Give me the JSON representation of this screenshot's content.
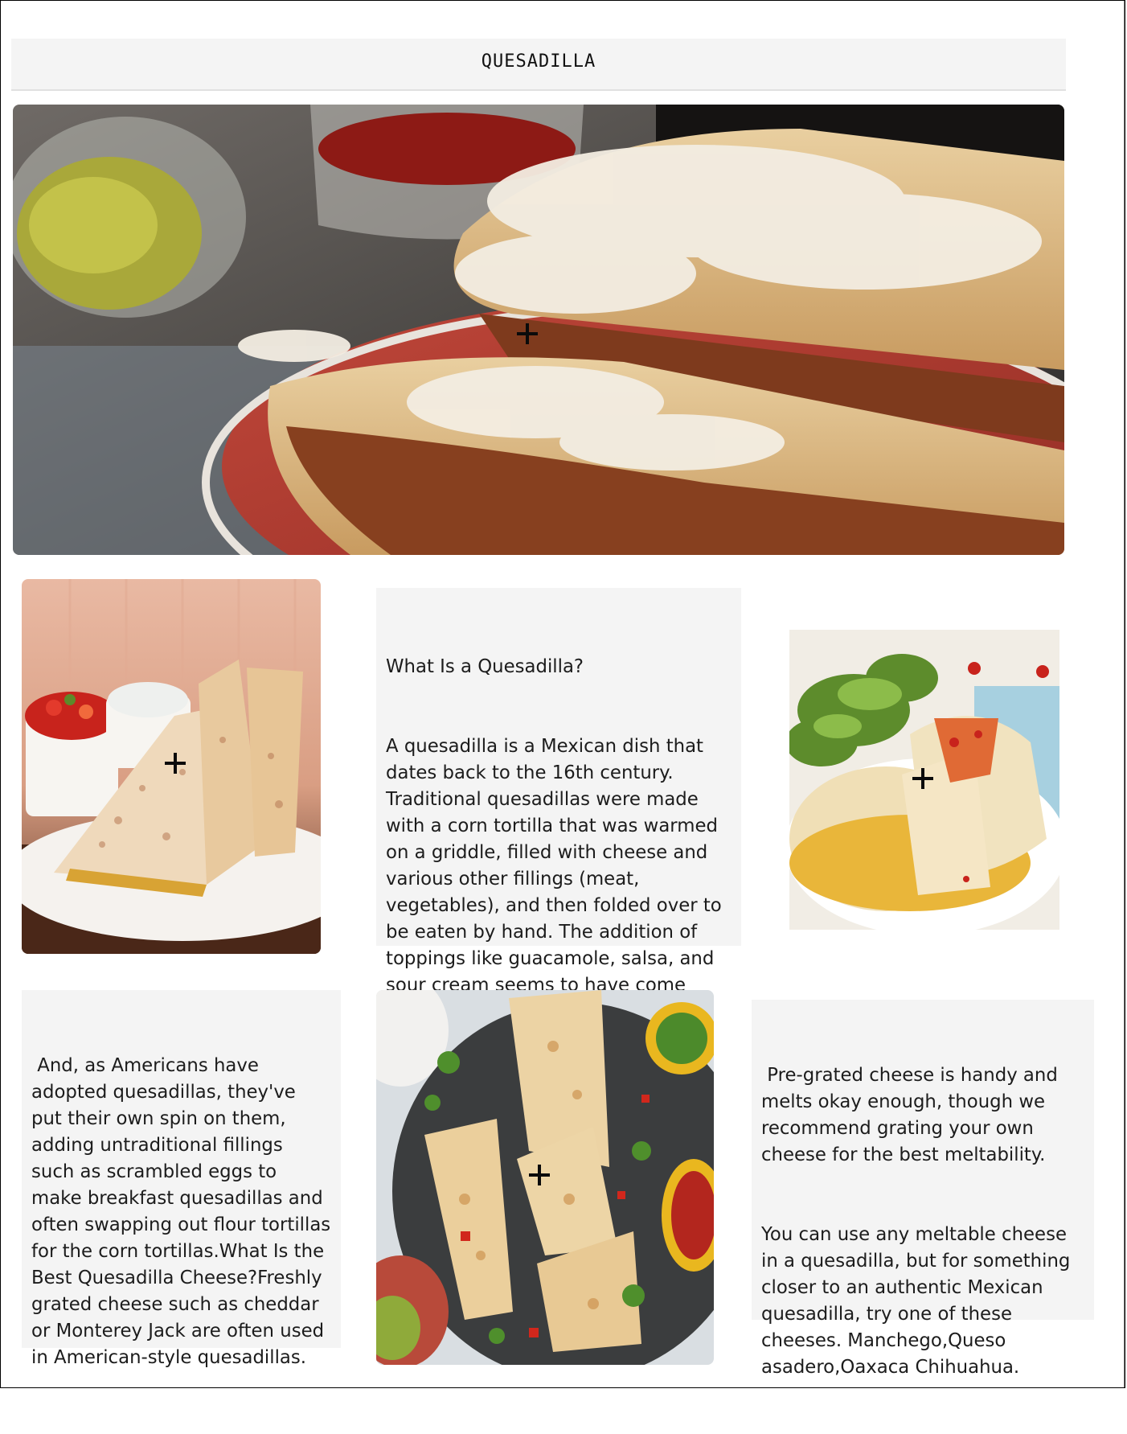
{
  "header": {
    "title": "QUESADILLA"
  },
  "hero": {
    "image": "quesadilla-plate-with-shredded-cheese-photo"
  },
  "gallery": [
    {
      "image": "quesadilla-wedges-with-salsa-and-sour-cream-photo"
    },
    {
      "image": "quesadilla-wedges-with-salad-photo"
    },
    {
      "image": "quesadilla-wedges-on-dark-plate-photo"
    }
  ],
  "cards": {
    "intro": {
      "heading": "What Is a Quesadilla?",
      "body": "A quesadilla is a Mexican dish that dates back to the 16th century. Traditional quesadillas were made with a corn tortilla that was warmed on a griddle, filled with cheese and various other fillings (meat, vegetables), and then folded over to be eaten by hand. The addition of toppings like guacamole, salsa, and sour cream seems to have come along later."
    },
    "americans": {
      "body": " And, as Americans have adopted quesadillas, they've put their own spin on them, adding untraditional fillings such as scrambled eggs to make breakfast quesadillas and often swapping out flour tortillas for the corn tortillas.What Is the Best Quesadilla Cheese?Freshly grated cheese such as cheddar or Monterey Jack are often used in American-style quesadillas."
    },
    "cheese": {
      "line1": " Pre-grated cheese is handy and melts okay enough, though we recommend grating your own cheese for the best meltability.",
      "line2": "You can use any meltable cheese in a quesadilla, but for something closer to an authentic Mexican quesadilla, try one of these cheeses. Manchego,Queso asadero,Oaxaca Chihuahua."
    }
  },
  "colors": {
    "card_bg": "#f4f4f4",
    "page_bg": "#ffffff",
    "border": "#000000"
  }
}
